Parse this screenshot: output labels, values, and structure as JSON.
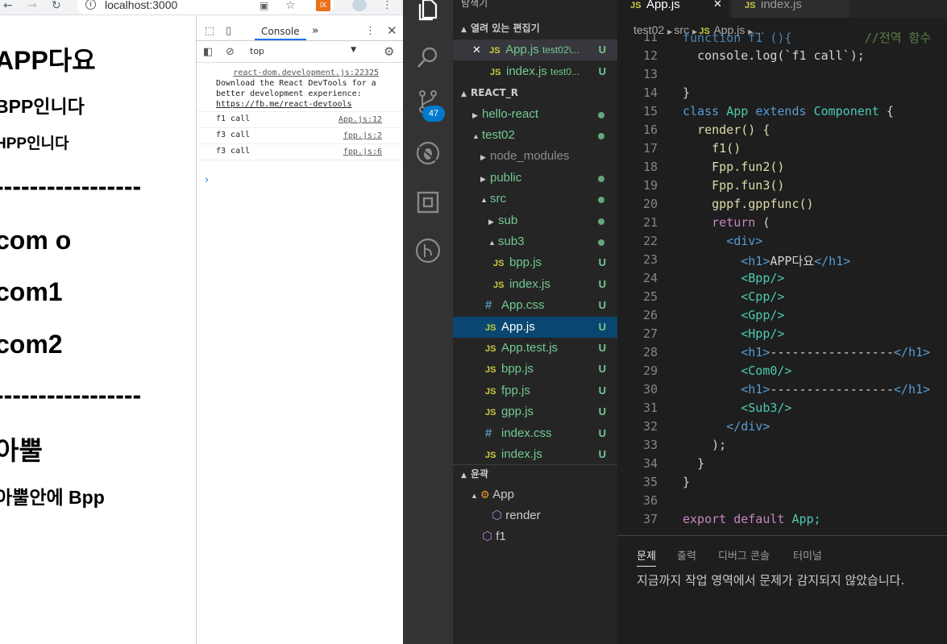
{
  "browser": {
    "url": "localhost:3000",
    "ext_label": "lX",
    "page": {
      "h_app": "APP다요",
      "h_bpp": "BPP인니다",
      "h_hpp": "HPP인니다",
      "dashes1": "-----------------",
      "com0": "com o",
      "com1": "com1",
      "com2": "com2",
      "dashes2": "-----------------",
      "sub3": "아뿔",
      "sub3_bpp": "아뿔안에 Bpp"
    }
  },
  "devtools": {
    "console_tab": "Console",
    "context": "top",
    "logs": [
      {
        "source": "react-dom.development.js:22325",
        "text": "Download the React DevTools for a better development experience: ",
        "link": "https://fb.me/react-devtools"
      },
      {
        "text": "f1 call",
        "source": "App.js:12"
      },
      {
        "text": "f3 call",
        "source": "fpp.js:2"
      },
      {
        "text": "f3 call",
        "source": "fpp.js:6"
      }
    ],
    "prompt": "›"
  },
  "vscode": {
    "badge": "47",
    "sidebar": {
      "explorer_title": "탐색기",
      "open_editors": "열려 있는 편집기",
      "open_items": [
        {
          "name": "App.js",
          "desc": "test02\\...",
          "status": "U"
        },
        {
          "name": "index.js",
          "desc": "test0...",
          "status": "U"
        }
      ],
      "project": "REACT_R",
      "tree": [
        {
          "name": "hello-react"
        },
        {
          "name": "test02"
        },
        {
          "name": "node_modules"
        },
        {
          "name": "public"
        },
        {
          "name": "src"
        },
        {
          "name": "sub"
        },
        {
          "name": "sub3"
        },
        {
          "name": "bpp.js",
          "status": "U"
        },
        {
          "name": "index.js",
          "status": "U"
        },
        {
          "name": "App.css",
          "status": "U"
        },
        {
          "name": "App.js",
          "status": "U"
        },
        {
          "name": "App.test.js",
          "status": "U"
        },
        {
          "name": "bpp.js",
          "status": "U"
        },
        {
          "name": "fpp.js",
          "status": "U"
        },
        {
          "name": "gpp.js",
          "status": "U"
        },
        {
          "name": "index.css",
          "status": "U"
        },
        {
          "name": "index.js",
          "status": "U"
        }
      ],
      "outline": "윤곽",
      "outline_items": [
        "App",
        "render",
        "f1"
      ]
    },
    "tabs": [
      {
        "label": "App.js"
      },
      {
        "label": "index.js"
      }
    ],
    "breadcrumb": [
      "test02",
      "src",
      "App.js",
      "..."
    ],
    "line_numbers": [
      "11",
      "12",
      "13",
      "14",
      "15",
      "16",
      "17",
      "18",
      "19",
      "20",
      "21",
      "22",
      "23",
      "24",
      "25",
      "26",
      "27",
      "28",
      "29",
      "30",
      "31",
      "32",
      "33",
      "34",
      "35",
      "36",
      "37"
    ],
    "code": {
      "l11": "function f1 (){",
      "l11c": "//전역 함수",
      "l12": "console.log(`f1 call`);",
      "l14": "}",
      "l15a": "class",
      "l15b": "App",
      "l15c": "extends",
      "l15d": "Component",
      "l15e": "{",
      "l16": "render() {",
      "l17": "f1()",
      "l18": "Fpp.fun2()",
      "l19": "Fpp.fun3()",
      "l20": "gppf.gppfunc()",
      "l21a": "return",
      "l21b": "(",
      "l22": "<div>",
      "l23a": "<h1>",
      "l23b": "APP다요",
      "l23c": "</h1>",
      "l24": "<Bpp/>",
      "l25": "<Cpp/>",
      "l26": "<Gpp/>",
      "l27": "<Hpp/>",
      "l28a": "<h1>",
      "l28b": "-----------------",
      "l28c": "</h1>",
      "l29": "<Com0/>",
      "l30a": "<h1>",
      "l30b": "-----------------",
      "l30c": "</h1>",
      "l31": "<Sub3/>",
      "l32": "</div>",
      "l33": ");",
      "l34": "}",
      "l35": "}",
      "l37a": "export",
      "l37b": "default",
      "l37c": "App;"
    },
    "panel": {
      "tabs": [
        "문제",
        "출력",
        "디버그 콘솔",
        "터미널"
      ],
      "message": "지금까지 작업 영역에서 문제가 감지되지 않았습니다."
    }
  },
  "colors": {
    "vscode_bg": "#1e1e1e",
    "sidebar_bg": "#252526",
    "activity_bg": "#333333",
    "selection": "#094771",
    "git_untracked": "#73c991",
    "accent": "#007acc"
  }
}
